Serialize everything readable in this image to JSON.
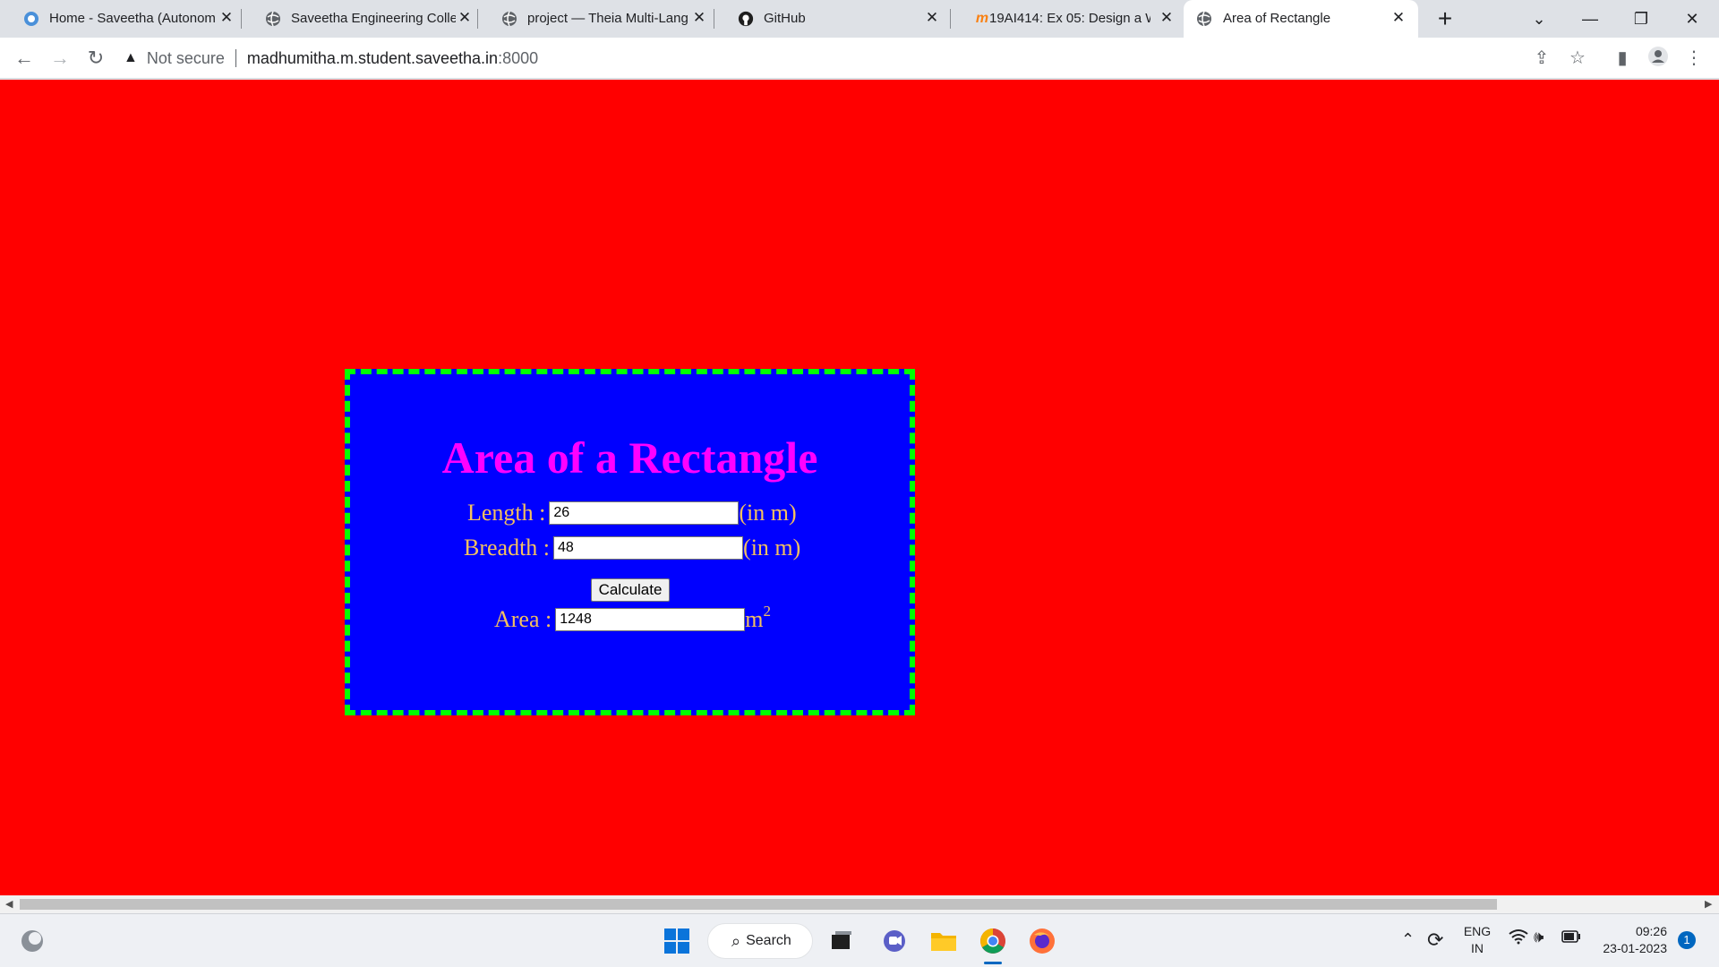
{
  "browser": {
    "tabs": [
      {
        "title": "Home - Saveetha (Autonom",
        "icon": "saveetha-icon"
      },
      {
        "title": "Saveetha Engineering Colle",
        "icon": "globe-icon"
      },
      {
        "title": "project — Theia Multi-Lang",
        "icon": "globe-icon"
      },
      {
        "title": "GitHub",
        "icon": "github-icon"
      },
      {
        "title": "19AI414: Ex 05: Design a W",
        "icon": "moodle-icon"
      },
      {
        "title": "Area of Rectangle",
        "icon": "globe-icon",
        "active": true
      }
    ],
    "address": {
      "security_label": "Not secure",
      "host": "madhumitha.m.student.saveetha.in",
      "port": ":8000"
    }
  },
  "page": {
    "heading": "Area of a Rectangle",
    "length_label": "Length :",
    "length_value": "26",
    "length_unit": "(in m)",
    "breadth_label": "Breadth :",
    "breadth_value": "48",
    "breadth_unit": "(in m)",
    "calculate_label": "Calculate",
    "area_label": "Area :",
    "area_value": "1248",
    "area_unit": "m",
    "area_unit_power": "2",
    "colors": {
      "background": "#ff0000",
      "card": "#0000ff",
      "border": "#00ff00",
      "heading": "#ff00ff"
    }
  },
  "taskbar": {
    "search_label": "Search",
    "lang_top": "ENG",
    "lang_bottom": "IN",
    "time": "09:26",
    "date": "23-01-2023",
    "notification_count": "1"
  }
}
